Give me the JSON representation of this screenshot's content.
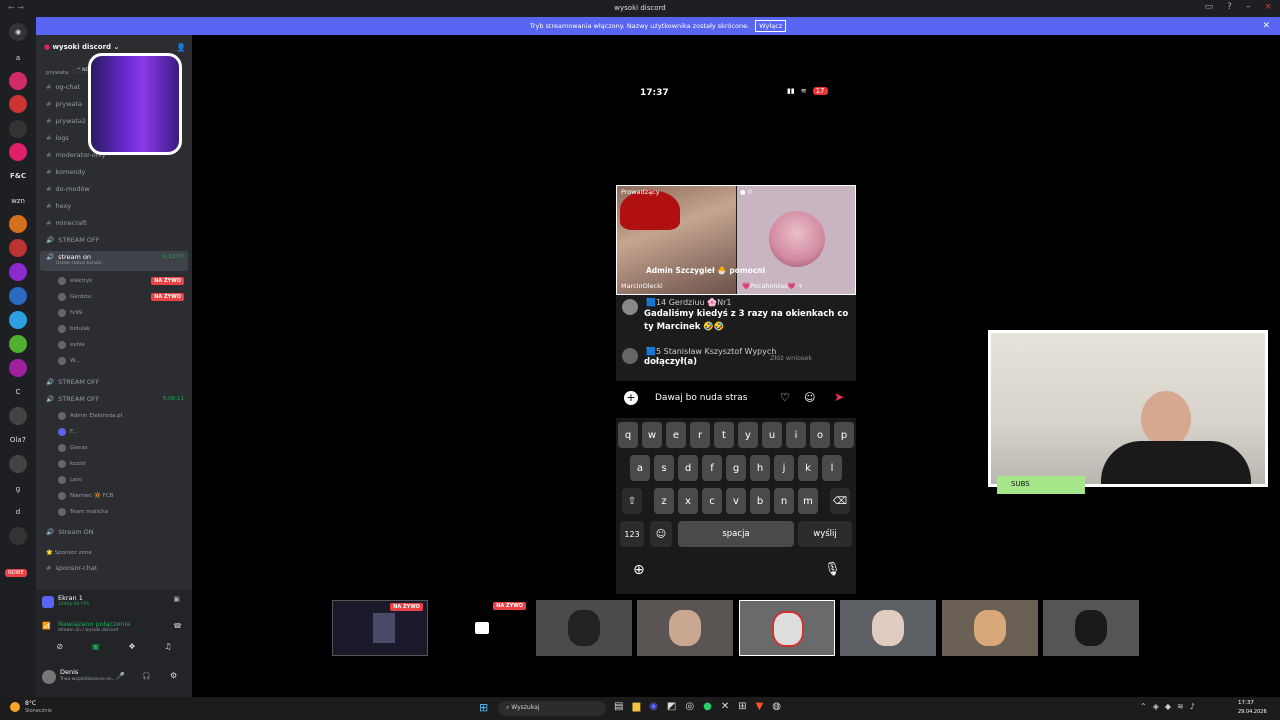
{
  "window": {
    "title": "wysoki discord"
  },
  "banner": {
    "text": "Tryb streamowania włączony. Nazwy użytkownika zostały skrócone.",
    "button": "Wyłącz"
  },
  "servers": [
    "a",
    "F&C",
    "wzn",
    "C",
    "Ola7",
    "g",
    "d"
  ],
  "servers_new": "NOWE",
  "channels": {
    "server_name": "wysoki discord",
    "prywatne_label": "prywata",
    "new_label": "NOWE",
    "text": [
      "og-chat",
      "prywata",
      "prywata2",
      "logs",
      "moderator-only",
      "komendy",
      "do-modów",
      "hexy",
      "minecraft"
    ],
    "voice1": "STREAM OFF",
    "selected": "stream on",
    "selected_status": "Ustaw status kanału",
    "selected_timer": "1:12:07",
    "voice1_users": [
      "elektryk",
      "Gerdziu",
      "fv99",
      "bidulak",
      "exhie",
      "W..."
    ],
    "voice2": "STREAM OFF",
    "voice3": "STREAM OFF",
    "voice3_timer": "5:06:11",
    "voice3_users": [
      "Admin Elektroda.pl",
      "F...",
      "Gieras",
      "koziol",
      "Lero",
      "Niemiec 🔆 FCB",
      "Team malicha"
    ],
    "voice4": "Stream ON",
    "sponsor": "Sponsor zone",
    "sponsor_chat": "sponsor-chat",
    "live": "NA ŻYWO"
  },
  "panel": {
    "screen_title": "Ekran 1",
    "screen_sub": "1440p 60 FPS",
    "connected": "Nawiązano połączenie",
    "connected_sub": "stream on / wysoki discord",
    "user": "Denis",
    "user_status": "Trwa współdzielenie ek..."
  },
  "phone": {
    "time": "17:37",
    "battery": "17",
    "host_label": "Prowadzący",
    "guest_count": "0",
    "host_name": "MarcinOlecki",
    "guest_name": "Pocahontas",
    "host_join": "Admin Szczygieł 🐣 pomocni",
    "comment_user": "Gerdziuu",
    "comment_badge": "Nr1",
    "comment_level": "14",
    "comment_text": "Gadaliśmy kiedyś z 3 razy na okienkach co ty Marcinek 🤣🤣",
    "join_user": "Stanisław Kszysztof Wypych",
    "join_level": "5",
    "join_text": "dołączył(a)",
    "request": "Złóż wniosek",
    "input_value": "Dawaj bo nuda stras",
    "keys_row1": [
      "q",
      "w",
      "e",
      "r",
      "t",
      "y",
      "u",
      "i",
      "o",
      "p"
    ],
    "keys_row2": [
      "a",
      "s",
      "d",
      "f",
      "g",
      "h",
      "j",
      "k",
      "l"
    ],
    "keys_row3": [
      "z",
      "x",
      "c",
      "v",
      "b",
      "n",
      "m"
    ],
    "key_123": "123",
    "key_space": "spacja",
    "key_send": "wyślij"
  },
  "strip": {
    "live": "NA ŻYWO"
  },
  "webcam": {
    "label": "SUBS"
  },
  "taskbar": {
    "weather": "8°C",
    "weather_sub": "Słonecznie",
    "search": "Wyszukaj",
    "time": "17:37",
    "date": "29.04.2026"
  },
  "colors": {
    "accent": "#5865f2",
    "live": "#ed4245",
    "online": "#23a55a",
    "subs": "#a7e58a"
  }
}
